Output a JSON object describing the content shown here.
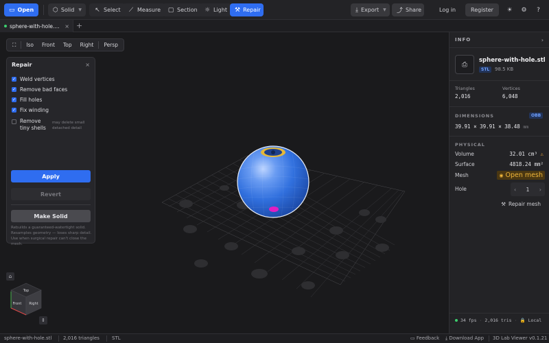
{
  "toolbar": {
    "open": "Open",
    "solid": "Solid",
    "select": "Select",
    "measure": "Measure",
    "section": "Section",
    "light": "Light",
    "repair": "Repair",
    "export": "Export",
    "share": "Share",
    "login": "Log in",
    "register": "Register"
  },
  "tabs": {
    "file_tab": "sphere-with-hole....",
    "add": "+"
  },
  "viewbar": {
    "items": [
      "Iso",
      "Front",
      "Top",
      "Right",
      "Persp"
    ]
  },
  "repair_panel": {
    "title": "Repair",
    "options": [
      {
        "label": "Weld vertices",
        "checked": true
      },
      {
        "label": "Remove bad faces",
        "checked": true
      },
      {
        "label": "Fill holes",
        "checked": true
      },
      {
        "label": "Fix winding",
        "checked": true
      }
    ],
    "shells_label": "Remove\ntiny shells",
    "shells_checked": false,
    "shells_note": "may delete small\ndetached detail",
    "apply": "Apply",
    "revert": "Revert",
    "make_solid": "Make Solid",
    "make_solid_note": "Rebuilds a guaranteed-watertight solid. Resamples geometry — loses sharp detail. Use when surgical repair can't close the mesh."
  },
  "cube": {
    "top": "Top",
    "front": "Front",
    "right": "Right"
  },
  "info": {
    "header": "INFO",
    "file_name": "sphere-with-hole.stl",
    "format": "STL",
    "size": "98.5 KB",
    "triangles_label": "Triangles",
    "triangles": "2,016",
    "vertices_label": "Vertices",
    "vertices": "6,048",
    "dimensions_label": "DIMENSIONS",
    "dims_mode": "OBB",
    "dims": "39.91 × 39.91 × 38.48",
    "dims_unit": "mm",
    "physical_label": "PHYSICAL",
    "volume_label": "Volume",
    "volume": "32.01 cm³",
    "surface_label": "Surface",
    "surface": "4818.24 mm²",
    "mesh_label": "Mesh",
    "mesh_status": "Open mesh",
    "hole_label": "Hole",
    "hole_value": "1",
    "repair_mesh": "Repair mesh",
    "fps": "34 fps",
    "tris": "2,016 tris",
    "local": "Local"
  },
  "statusbar": {
    "file": "sphere-with-hole.stl",
    "triangles": "2,016 triangles",
    "format": "STL",
    "feedback": "Feedback",
    "download": "Download App",
    "version": "3D Lab Viewer v0.1.21"
  },
  "colors": {
    "accent": "#2f6df0",
    "warning": "#f0b63a",
    "panel": "#26262a"
  }
}
